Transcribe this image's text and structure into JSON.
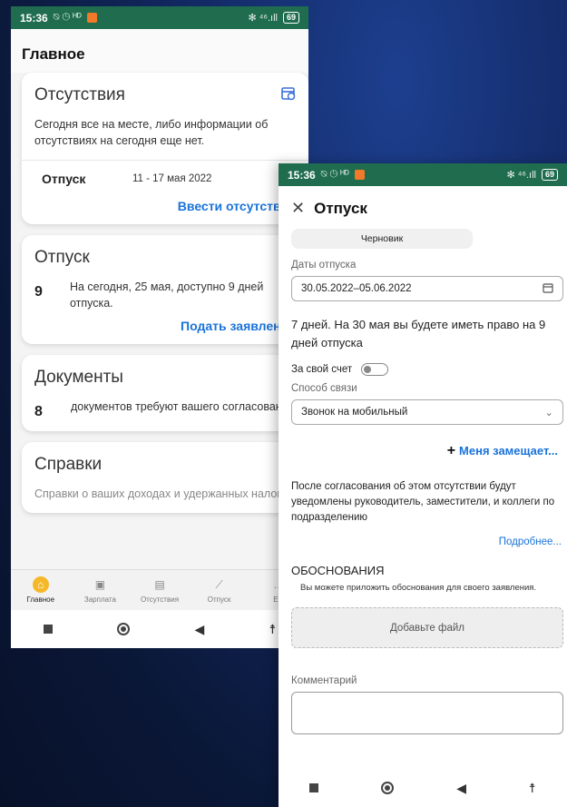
{
  "phone1": {
    "status": {
      "time": "15:36",
      "icons": "⍉ ◷ ᴴᴰ",
      "right_icons": "✻ ⁴⁶.ıll",
      "battery": "69"
    },
    "title": "Главное",
    "absences": {
      "title": "Отсутствия",
      "text": "Сегодня все на месте, либо информации об отсутствиях на сегодня еще нет.",
      "row_label": "Отпуск",
      "row_dates": "11 - 17 мая 2022",
      "link": "Ввести отсутствие"
    },
    "vacation": {
      "title": "Отпуск",
      "number": "9",
      "text": "На сегодня, 25 мая, доступно 9 дней отпуска.",
      "link": "Подать заявление"
    },
    "documents": {
      "title": "Документы",
      "number": "8",
      "text": "документов требуют вашего согласования"
    },
    "certificates": {
      "title": "Справки",
      "text": "Справки о ваших доходах и удержанных налогах"
    },
    "nav": [
      {
        "label": "Главное",
        "icon": "home-icon"
      },
      {
        "label": "Зарплата",
        "icon": "wallet-icon"
      },
      {
        "label": "Отсутствия",
        "icon": "calendar-icon"
      },
      {
        "label": "Отпуск",
        "icon": "beach-icon"
      },
      {
        "label": "Ещ",
        "icon": "more-icon"
      }
    ]
  },
  "phone2": {
    "status": {
      "time": "15:36",
      "icons": "⍉ ◷ ᴴᴰ",
      "right_icons": "✻ ⁴⁶.ıll",
      "battery": "69"
    },
    "title": "Отпуск",
    "status_chip": "Черновик",
    "dates_label": "Даты отпуска",
    "dates_value": "30.05.2022–05.06.2022",
    "info": "7 дней. На 30 мая вы будете иметь право на 9 дней отпуска",
    "own_expense_label": "За свой счет",
    "contact_label": "Способ связи",
    "contact_value": "Звонок на мобильный",
    "replaces_link": "Меня замещает...",
    "note": "После согласования об этом отсутствии будут уведомлены руководитель, заместители, и коллеги по подразделению",
    "more_link": "Подробнее...",
    "reasons_title": "ОБОСНОВАНИЯ",
    "reasons_hint": "Вы можете приложить обоснования для своего заявления.",
    "add_file": "Добавьте файл",
    "comment_label": "Комментарий"
  },
  "colors": {
    "accent": "#1a73d9",
    "status_bar": "#1f6d4e",
    "nav_active": "#f5b829"
  }
}
